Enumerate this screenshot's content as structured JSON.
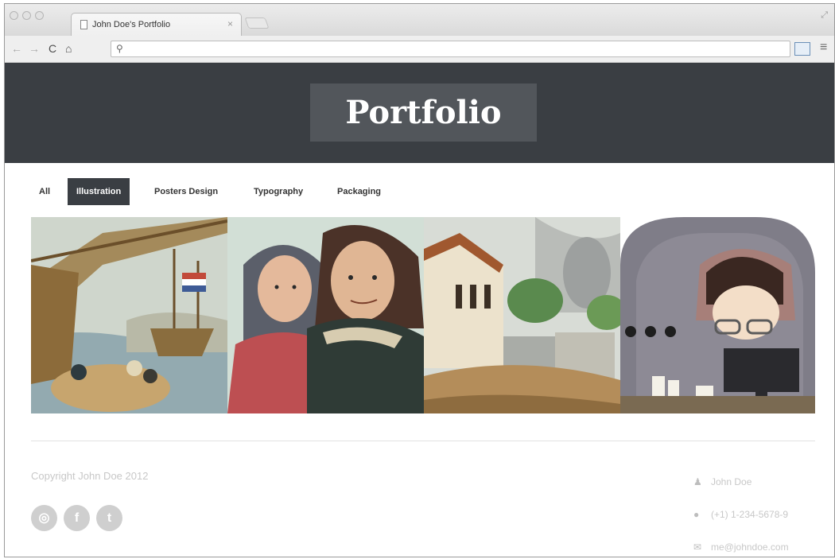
{
  "browser": {
    "tab_title": "John Doe's Portfolio",
    "tab_close": "×",
    "search_glyph": "⚲",
    "url": ""
  },
  "site": {
    "logo": "Portfolio",
    "filters": [
      {
        "label": "All",
        "active": false
      },
      {
        "label": "Illustration",
        "active": true
      },
      {
        "label": "Posters Design",
        "active": false
      },
      {
        "label": "Typography",
        "active": false
      },
      {
        "label": "Packaging",
        "active": false
      }
    ],
    "gallery": [
      {
        "name": "ships-illustration"
      },
      {
        "name": "characters-illustration"
      },
      {
        "name": "village-illustration"
      },
      {
        "name": "computer-user-illustration"
      }
    ]
  },
  "footer": {
    "copyright": "Copyright John Doe 2012",
    "social": [
      {
        "icon": "dribbble-icon",
        "glyph": "◎"
      },
      {
        "icon": "facebook-icon",
        "glyph": "f"
      },
      {
        "icon": "twitter-icon",
        "glyph": "t"
      }
    ],
    "contact": {
      "name": "John Doe",
      "phone": "(+1) 1-234-5678-9",
      "email": "me@johndoe.com"
    }
  },
  "colors": {
    "header_bg": "#3a3e43",
    "logo_bg": "#52565b",
    "active_filter_bg": "#3a3e43",
    "footer_text": "#c8c8c8"
  }
}
